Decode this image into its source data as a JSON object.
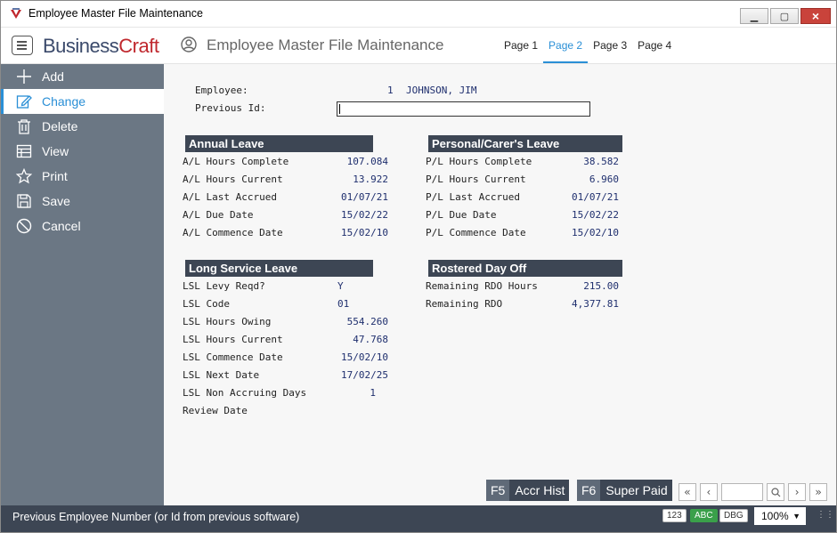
{
  "window": {
    "title": "Employee Master File Maintenance"
  },
  "header": {
    "logo_part1": "Business",
    "logo_part2": "Craft",
    "title": "Employee Master File Maintenance",
    "tabs": [
      {
        "label": "Page 1",
        "active": false
      },
      {
        "label": "Page 2",
        "active": true
      },
      {
        "label": "Page 3",
        "active": false
      },
      {
        "label": "Page 4",
        "active": false
      }
    ]
  },
  "sidebar": {
    "items": [
      {
        "label": "Add",
        "icon": "plus-icon"
      },
      {
        "label": "Change",
        "icon": "edit-icon",
        "active": true
      },
      {
        "label": "Delete",
        "icon": "trash-icon"
      },
      {
        "label": "View",
        "icon": "table-icon"
      },
      {
        "label": "Print",
        "icon": "star-icon"
      },
      {
        "label": "Save",
        "icon": "floppy-icon"
      },
      {
        "label": "Cancel",
        "icon": "cancel-icon"
      }
    ]
  },
  "form": {
    "employee_label": "Employee:",
    "employee_number": "1",
    "employee_name": "JOHNSON, JIM",
    "previous_id_label": "Previous Id:",
    "previous_id_value": ""
  },
  "annual_leave": {
    "heading": "Annual Leave",
    "rows": [
      {
        "label": "A/L Hours Complete",
        "value": "107.084"
      },
      {
        "label": "A/L Hours Current",
        "value": "13.922"
      },
      {
        "label": "A/L Last Accrued",
        "value": "01/07/21"
      },
      {
        "label": "A/L Due Date",
        "value": "15/02/22"
      },
      {
        "label": "A/L Commence Date",
        "value": "15/02/10"
      }
    ]
  },
  "personal_leave": {
    "heading": "Personal/Carer's Leave",
    "rows": [
      {
        "label": "P/L Hours Complete",
        "value": "38.582"
      },
      {
        "label": "P/L Hours Current",
        "value": "6.960"
      },
      {
        "label": "P/L Last Accrued",
        "value": "01/07/21"
      },
      {
        "label": "P/L Due Date",
        "value": "15/02/22"
      },
      {
        "label": "P/L Commence Date",
        "value": "15/02/10"
      }
    ]
  },
  "long_service_leave": {
    "heading": "Long Service Leave",
    "rows": [
      {
        "label": "LSL Levy Reqd?",
        "value": "Y"
      },
      {
        "label": "LSL Code",
        "value": "01"
      },
      {
        "label": "LSL Hours Owing",
        "value": "554.260"
      },
      {
        "label": "LSL Hours Current",
        "value": "47.768"
      },
      {
        "label": "LSL Commence Date",
        "value": "15/02/10"
      },
      {
        "label": "LSL Next Date",
        "value": "17/02/25"
      },
      {
        "label": "LSL Non Accruing Days",
        "value": "1"
      },
      {
        "label": "Review Date",
        "value": ""
      }
    ]
  },
  "rostered_day_off": {
    "heading": "Rostered Day Off",
    "rows": [
      {
        "label": "Remaining RDO Hours",
        "value": "215.00"
      },
      {
        "label": "Remaining RDO",
        "value": "4,377.81"
      }
    ]
  },
  "function_buttons": [
    {
      "key": "F5",
      "label": "Accr Hist"
    },
    {
      "key": "F6",
      "label": "Super Paid"
    }
  ],
  "status": {
    "message": "Previous Employee Number (or Id from previous software)",
    "badge_num": "123",
    "badge_abc": "ABC",
    "badge_dbg": "DBG",
    "zoom": "100%"
  }
}
